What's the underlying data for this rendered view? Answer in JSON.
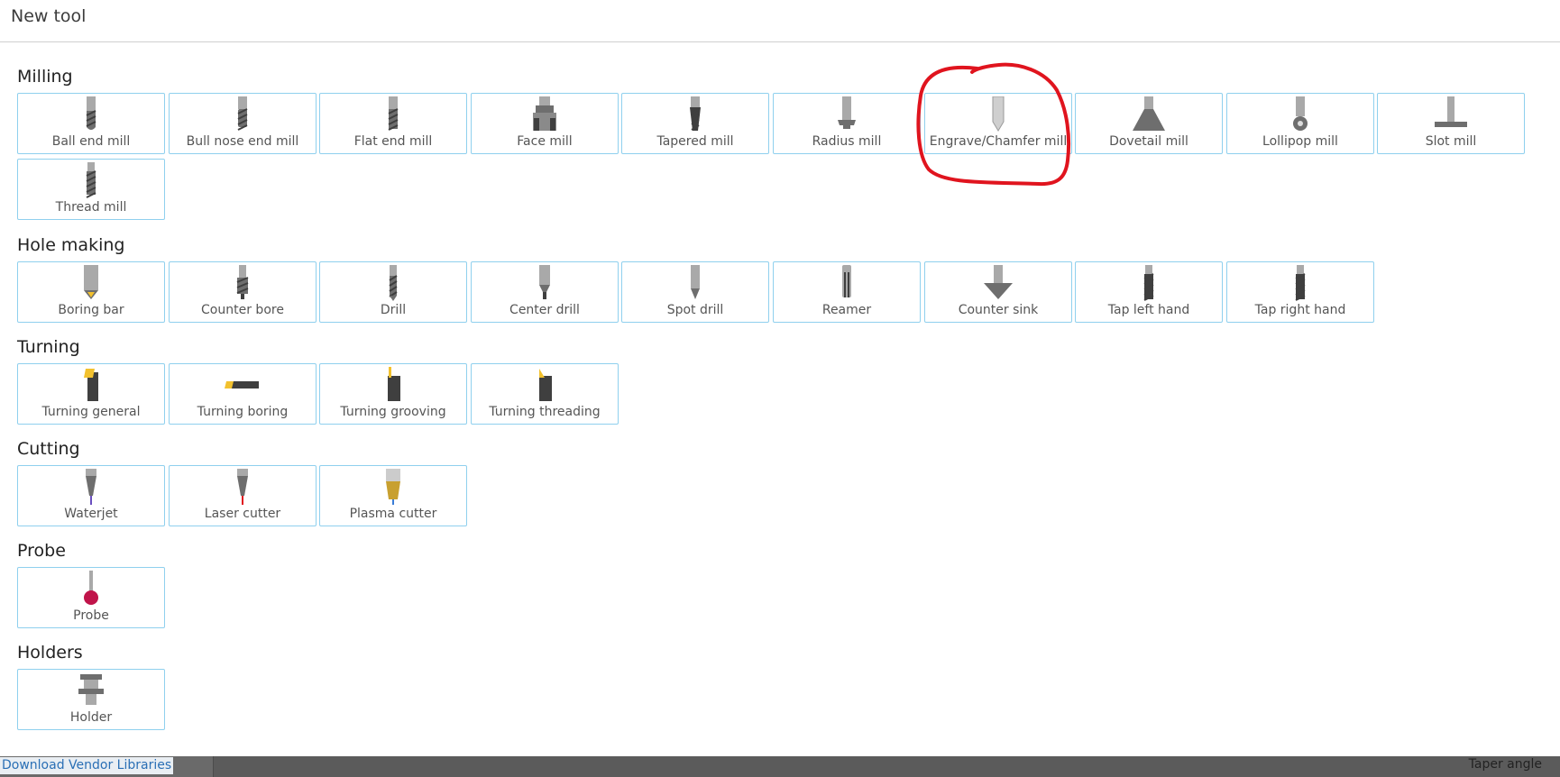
{
  "dialog": {
    "title": "New tool"
  },
  "sections": [
    {
      "title": "Milling",
      "tools": [
        {
          "label": "Ball end mill",
          "icon": "ball-end-mill-icon"
        },
        {
          "label": "Bull nose end mill",
          "icon": "bull-nose-end-mill-icon"
        },
        {
          "label": "Flat end mill",
          "icon": "flat-end-mill-icon"
        },
        {
          "label": "Face mill",
          "icon": "face-mill-icon"
        },
        {
          "label": "Tapered mill",
          "icon": "tapered-mill-icon"
        },
        {
          "label": "Radius mill",
          "icon": "radius-mill-icon"
        },
        {
          "label": "Engrave/Chamfer mill",
          "icon": "engrave-chamfer-mill-icon"
        },
        {
          "label": "Dovetail mill",
          "icon": "dovetail-mill-icon"
        },
        {
          "label": "Lollipop mill",
          "icon": "lollipop-mill-icon"
        },
        {
          "label": "Slot mill",
          "icon": "slot-mill-icon"
        },
        {
          "label": "Thread mill",
          "icon": "thread-mill-icon"
        }
      ]
    },
    {
      "title": "Hole making",
      "tools": [
        {
          "label": "Boring bar",
          "icon": "boring-bar-icon"
        },
        {
          "label": "Counter bore",
          "icon": "counter-bore-icon"
        },
        {
          "label": "Drill",
          "icon": "drill-icon"
        },
        {
          "label": "Center drill",
          "icon": "center-drill-icon"
        },
        {
          "label": "Spot drill",
          "icon": "spot-drill-icon"
        },
        {
          "label": "Reamer",
          "icon": "reamer-icon"
        },
        {
          "label": "Counter sink",
          "icon": "counter-sink-icon"
        },
        {
          "label": "Tap left hand",
          "icon": "tap-left-hand-icon"
        },
        {
          "label": "Tap right hand",
          "icon": "tap-right-hand-icon"
        }
      ]
    },
    {
      "title": "Turning",
      "tools": [
        {
          "label": "Turning general",
          "icon": "turning-general-icon"
        },
        {
          "label": "Turning boring",
          "icon": "turning-boring-icon"
        },
        {
          "label": "Turning grooving",
          "icon": "turning-grooving-icon"
        },
        {
          "label": "Turning threading",
          "icon": "turning-threading-icon"
        }
      ]
    },
    {
      "title": "Cutting",
      "tools": [
        {
          "label": "Waterjet",
          "icon": "waterjet-icon"
        },
        {
          "label": "Laser cutter",
          "icon": "laser-cutter-icon"
        },
        {
          "label": "Plasma cutter",
          "icon": "plasma-cutter-icon"
        }
      ]
    },
    {
      "title": "Probe",
      "tools": [
        {
          "label": "Probe",
          "icon": "probe-icon"
        }
      ]
    },
    {
      "title": "Holders",
      "tools": [
        {
          "label": "Holder",
          "icon": "holder-icon"
        }
      ]
    }
  ],
  "annotation": {
    "highlighted_tool": "Engrave/Chamfer mill",
    "color": "#e0141e"
  },
  "footer": {
    "vendor_link": "Download Vendor Libraries",
    "right_text": "Taper angle"
  },
  "colors": {
    "tile_border": "#8fd0ee",
    "link": "#2a6fb5"
  }
}
